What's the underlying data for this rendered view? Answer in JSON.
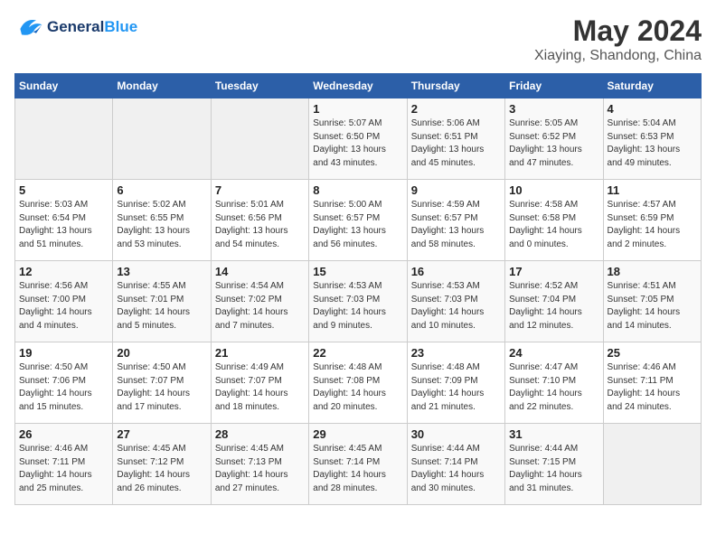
{
  "header": {
    "logo_line1": "General",
    "logo_line2": "Blue",
    "month_year": "May 2024",
    "location": "Xiaying, Shandong, China"
  },
  "weekdays": [
    "Sunday",
    "Monday",
    "Tuesday",
    "Wednesday",
    "Thursday",
    "Friday",
    "Saturday"
  ],
  "weeks": [
    [
      {
        "day": "",
        "sunrise": "",
        "sunset": "",
        "daylight": ""
      },
      {
        "day": "",
        "sunrise": "",
        "sunset": "",
        "daylight": ""
      },
      {
        "day": "",
        "sunrise": "",
        "sunset": "",
        "daylight": ""
      },
      {
        "day": "1",
        "sunrise": "Sunrise: 5:07 AM",
        "sunset": "Sunset: 6:50 PM",
        "daylight": "Daylight: 13 hours and 43 minutes."
      },
      {
        "day": "2",
        "sunrise": "Sunrise: 5:06 AM",
        "sunset": "Sunset: 6:51 PM",
        "daylight": "Daylight: 13 hours and 45 minutes."
      },
      {
        "day": "3",
        "sunrise": "Sunrise: 5:05 AM",
        "sunset": "Sunset: 6:52 PM",
        "daylight": "Daylight: 13 hours and 47 minutes."
      },
      {
        "day": "4",
        "sunrise": "Sunrise: 5:04 AM",
        "sunset": "Sunset: 6:53 PM",
        "daylight": "Daylight: 13 hours and 49 minutes."
      }
    ],
    [
      {
        "day": "5",
        "sunrise": "Sunrise: 5:03 AM",
        "sunset": "Sunset: 6:54 PM",
        "daylight": "Daylight: 13 hours and 51 minutes."
      },
      {
        "day": "6",
        "sunrise": "Sunrise: 5:02 AM",
        "sunset": "Sunset: 6:55 PM",
        "daylight": "Daylight: 13 hours and 53 minutes."
      },
      {
        "day": "7",
        "sunrise": "Sunrise: 5:01 AM",
        "sunset": "Sunset: 6:56 PM",
        "daylight": "Daylight: 13 hours and 54 minutes."
      },
      {
        "day": "8",
        "sunrise": "Sunrise: 5:00 AM",
        "sunset": "Sunset: 6:57 PM",
        "daylight": "Daylight: 13 hours and 56 minutes."
      },
      {
        "day": "9",
        "sunrise": "Sunrise: 4:59 AM",
        "sunset": "Sunset: 6:57 PM",
        "daylight": "Daylight: 13 hours and 58 minutes."
      },
      {
        "day": "10",
        "sunrise": "Sunrise: 4:58 AM",
        "sunset": "Sunset: 6:58 PM",
        "daylight": "Daylight: 14 hours and 0 minutes."
      },
      {
        "day": "11",
        "sunrise": "Sunrise: 4:57 AM",
        "sunset": "Sunset: 6:59 PM",
        "daylight": "Daylight: 14 hours and 2 minutes."
      }
    ],
    [
      {
        "day": "12",
        "sunrise": "Sunrise: 4:56 AM",
        "sunset": "Sunset: 7:00 PM",
        "daylight": "Daylight: 14 hours and 4 minutes."
      },
      {
        "day": "13",
        "sunrise": "Sunrise: 4:55 AM",
        "sunset": "Sunset: 7:01 PM",
        "daylight": "Daylight: 14 hours and 5 minutes."
      },
      {
        "day": "14",
        "sunrise": "Sunrise: 4:54 AM",
        "sunset": "Sunset: 7:02 PM",
        "daylight": "Daylight: 14 hours and 7 minutes."
      },
      {
        "day": "15",
        "sunrise": "Sunrise: 4:53 AM",
        "sunset": "Sunset: 7:03 PM",
        "daylight": "Daylight: 14 hours and 9 minutes."
      },
      {
        "day": "16",
        "sunrise": "Sunrise: 4:53 AM",
        "sunset": "Sunset: 7:03 PM",
        "daylight": "Daylight: 14 hours and 10 minutes."
      },
      {
        "day": "17",
        "sunrise": "Sunrise: 4:52 AM",
        "sunset": "Sunset: 7:04 PM",
        "daylight": "Daylight: 14 hours and 12 minutes."
      },
      {
        "day": "18",
        "sunrise": "Sunrise: 4:51 AM",
        "sunset": "Sunset: 7:05 PM",
        "daylight": "Daylight: 14 hours and 14 minutes."
      }
    ],
    [
      {
        "day": "19",
        "sunrise": "Sunrise: 4:50 AM",
        "sunset": "Sunset: 7:06 PM",
        "daylight": "Daylight: 14 hours and 15 minutes."
      },
      {
        "day": "20",
        "sunrise": "Sunrise: 4:50 AM",
        "sunset": "Sunset: 7:07 PM",
        "daylight": "Daylight: 14 hours and 17 minutes."
      },
      {
        "day": "21",
        "sunrise": "Sunrise: 4:49 AM",
        "sunset": "Sunset: 7:07 PM",
        "daylight": "Daylight: 14 hours and 18 minutes."
      },
      {
        "day": "22",
        "sunrise": "Sunrise: 4:48 AM",
        "sunset": "Sunset: 7:08 PM",
        "daylight": "Daylight: 14 hours and 20 minutes."
      },
      {
        "day": "23",
        "sunrise": "Sunrise: 4:48 AM",
        "sunset": "Sunset: 7:09 PM",
        "daylight": "Daylight: 14 hours and 21 minutes."
      },
      {
        "day": "24",
        "sunrise": "Sunrise: 4:47 AM",
        "sunset": "Sunset: 7:10 PM",
        "daylight": "Daylight: 14 hours and 22 minutes."
      },
      {
        "day": "25",
        "sunrise": "Sunrise: 4:46 AM",
        "sunset": "Sunset: 7:11 PM",
        "daylight": "Daylight: 14 hours and 24 minutes."
      }
    ],
    [
      {
        "day": "26",
        "sunrise": "Sunrise: 4:46 AM",
        "sunset": "Sunset: 7:11 PM",
        "daylight": "Daylight: 14 hours and 25 minutes."
      },
      {
        "day": "27",
        "sunrise": "Sunrise: 4:45 AM",
        "sunset": "Sunset: 7:12 PM",
        "daylight": "Daylight: 14 hours and 26 minutes."
      },
      {
        "day": "28",
        "sunrise": "Sunrise: 4:45 AM",
        "sunset": "Sunset: 7:13 PM",
        "daylight": "Daylight: 14 hours and 27 minutes."
      },
      {
        "day": "29",
        "sunrise": "Sunrise: 4:45 AM",
        "sunset": "Sunset: 7:14 PM",
        "daylight": "Daylight: 14 hours and 28 minutes."
      },
      {
        "day": "30",
        "sunrise": "Sunrise: 4:44 AM",
        "sunset": "Sunset: 7:14 PM",
        "daylight": "Daylight: 14 hours and 30 minutes."
      },
      {
        "day": "31",
        "sunrise": "Sunrise: 4:44 AM",
        "sunset": "Sunset: 7:15 PM",
        "daylight": "Daylight: 14 hours and 31 minutes."
      },
      {
        "day": "",
        "sunrise": "",
        "sunset": "",
        "daylight": ""
      }
    ]
  ]
}
